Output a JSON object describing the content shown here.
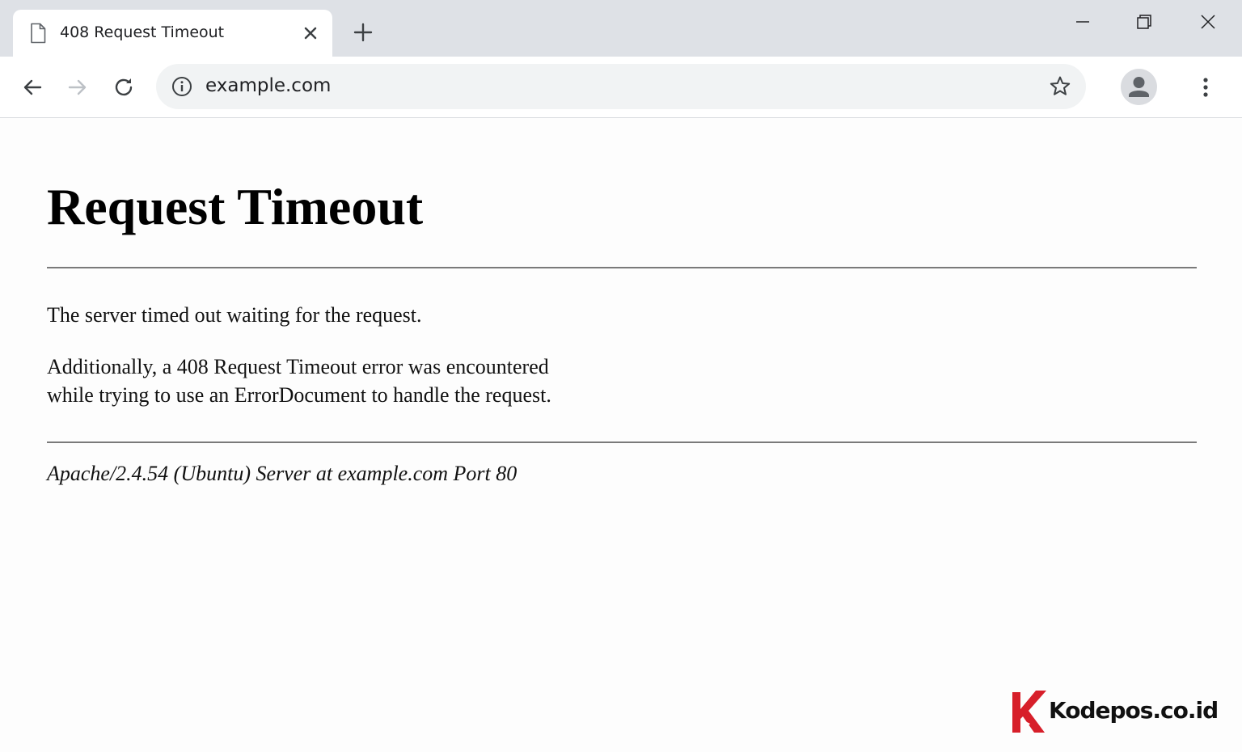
{
  "window": {
    "tab_title": "408 Request Timeout",
    "tab_icon": "document-icon",
    "controls": [
      "minimize-icon",
      "restore-icon",
      "close-icon"
    ]
  },
  "toolbar": {
    "url": "example.com",
    "icons": [
      "back-arrow-icon",
      "forward-arrow-icon",
      "reload-icon",
      "info-icon",
      "star-icon",
      "avatar-icon",
      "menu-dots-icon"
    ]
  },
  "page": {
    "heading": "Request Timeout",
    "message_1": "The server timed out waiting for the request.",
    "message_2_line_1": "Additionally, a 408 Request Timeout error was encountered",
    "message_2_line_2": "while trying to use an ErrorDocument to handle the request.",
    "address": "Apache/2.4.54 (Ubuntu) Server at example.com Port 80"
  },
  "watermark": {
    "text": "Kodepos.co.id",
    "logo_color": "#d71f2a"
  },
  "colors": {
    "tabstrip_bg": "#dee1e6",
    "omnibox_bg": "#f1f3f4",
    "rule": "#7a7a7a"
  }
}
